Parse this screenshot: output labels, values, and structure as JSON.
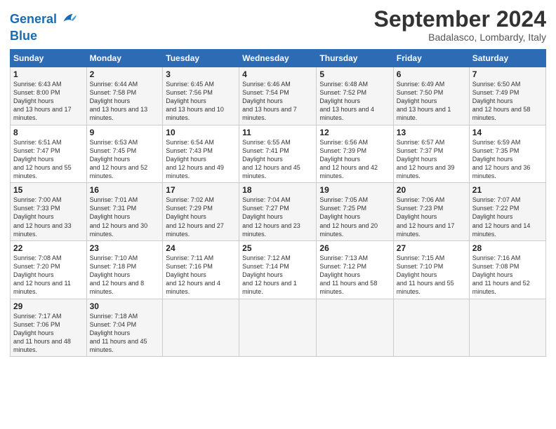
{
  "header": {
    "logo_line1": "General",
    "logo_line2": "Blue",
    "month": "September 2024",
    "location": "Badalasco, Lombardy, Italy"
  },
  "days_of_week": [
    "Sunday",
    "Monday",
    "Tuesday",
    "Wednesday",
    "Thursday",
    "Friday",
    "Saturday"
  ],
  "weeks": [
    [
      {
        "day": "1",
        "sunrise": "6:43 AM",
        "sunset": "8:00 PM",
        "daylight": "13 hours and 17 minutes."
      },
      {
        "day": "2",
        "sunrise": "6:44 AM",
        "sunset": "7:58 PM",
        "daylight": "13 hours and 13 minutes."
      },
      {
        "day": "3",
        "sunrise": "6:45 AM",
        "sunset": "7:56 PM",
        "daylight": "13 hours and 10 minutes."
      },
      {
        "day": "4",
        "sunrise": "6:46 AM",
        "sunset": "7:54 PM",
        "daylight": "13 hours and 7 minutes."
      },
      {
        "day": "5",
        "sunrise": "6:48 AM",
        "sunset": "7:52 PM",
        "daylight": "13 hours and 4 minutes."
      },
      {
        "day": "6",
        "sunrise": "6:49 AM",
        "sunset": "7:50 PM",
        "daylight": "13 hours and 1 minute."
      },
      {
        "day": "7",
        "sunrise": "6:50 AM",
        "sunset": "7:49 PM",
        "daylight": "12 hours and 58 minutes."
      }
    ],
    [
      {
        "day": "8",
        "sunrise": "6:51 AM",
        "sunset": "7:47 PM",
        "daylight": "12 hours and 55 minutes."
      },
      {
        "day": "9",
        "sunrise": "6:53 AM",
        "sunset": "7:45 PM",
        "daylight": "12 hours and 52 minutes."
      },
      {
        "day": "10",
        "sunrise": "6:54 AM",
        "sunset": "7:43 PM",
        "daylight": "12 hours and 49 minutes."
      },
      {
        "day": "11",
        "sunrise": "6:55 AM",
        "sunset": "7:41 PM",
        "daylight": "12 hours and 45 minutes."
      },
      {
        "day": "12",
        "sunrise": "6:56 AM",
        "sunset": "7:39 PM",
        "daylight": "12 hours and 42 minutes."
      },
      {
        "day": "13",
        "sunrise": "6:57 AM",
        "sunset": "7:37 PM",
        "daylight": "12 hours and 39 minutes."
      },
      {
        "day": "14",
        "sunrise": "6:59 AM",
        "sunset": "7:35 PM",
        "daylight": "12 hours and 36 minutes."
      }
    ],
    [
      {
        "day": "15",
        "sunrise": "7:00 AM",
        "sunset": "7:33 PM",
        "daylight": "12 hours and 33 minutes."
      },
      {
        "day": "16",
        "sunrise": "7:01 AM",
        "sunset": "7:31 PM",
        "daylight": "12 hours and 30 minutes."
      },
      {
        "day": "17",
        "sunrise": "7:02 AM",
        "sunset": "7:29 PM",
        "daylight": "12 hours and 27 minutes."
      },
      {
        "day": "18",
        "sunrise": "7:04 AM",
        "sunset": "7:27 PM",
        "daylight": "12 hours and 23 minutes."
      },
      {
        "day": "19",
        "sunrise": "7:05 AM",
        "sunset": "7:25 PM",
        "daylight": "12 hours and 20 minutes."
      },
      {
        "day": "20",
        "sunrise": "7:06 AM",
        "sunset": "7:23 PM",
        "daylight": "12 hours and 17 minutes."
      },
      {
        "day": "21",
        "sunrise": "7:07 AM",
        "sunset": "7:22 PM",
        "daylight": "12 hours and 14 minutes."
      }
    ],
    [
      {
        "day": "22",
        "sunrise": "7:08 AM",
        "sunset": "7:20 PM",
        "daylight": "12 hours and 11 minutes."
      },
      {
        "day": "23",
        "sunrise": "7:10 AM",
        "sunset": "7:18 PM",
        "daylight": "12 hours and 8 minutes."
      },
      {
        "day": "24",
        "sunrise": "7:11 AM",
        "sunset": "7:16 PM",
        "daylight": "12 hours and 4 minutes."
      },
      {
        "day": "25",
        "sunrise": "7:12 AM",
        "sunset": "7:14 PM",
        "daylight": "12 hours and 1 minute."
      },
      {
        "day": "26",
        "sunrise": "7:13 AM",
        "sunset": "7:12 PM",
        "daylight": "11 hours and 58 minutes."
      },
      {
        "day": "27",
        "sunrise": "7:15 AM",
        "sunset": "7:10 PM",
        "daylight": "11 hours and 55 minutes."
      },
      {
        "day": "28",
        "sunrise": "7:16 AM",
        "sunset": "7:08 PM",
        "daylight": "11 hours and 52 minutes."
      }
    ],
    [
      {
        "day": "29",
        "sunrise": "7:17 AM",
        "sunset": "7:06 PM",
        "daylight": "11 hours and 48 minutes."
      },
      {
        "day": "30",
        "sunrise": "7:18 AM",
        "sunset": "7:04 PM",
        "daylight": "11 hours and 45 minutes."
      },
      null,
      null,
      null,
      null,
      null
    ]
  ]
}
